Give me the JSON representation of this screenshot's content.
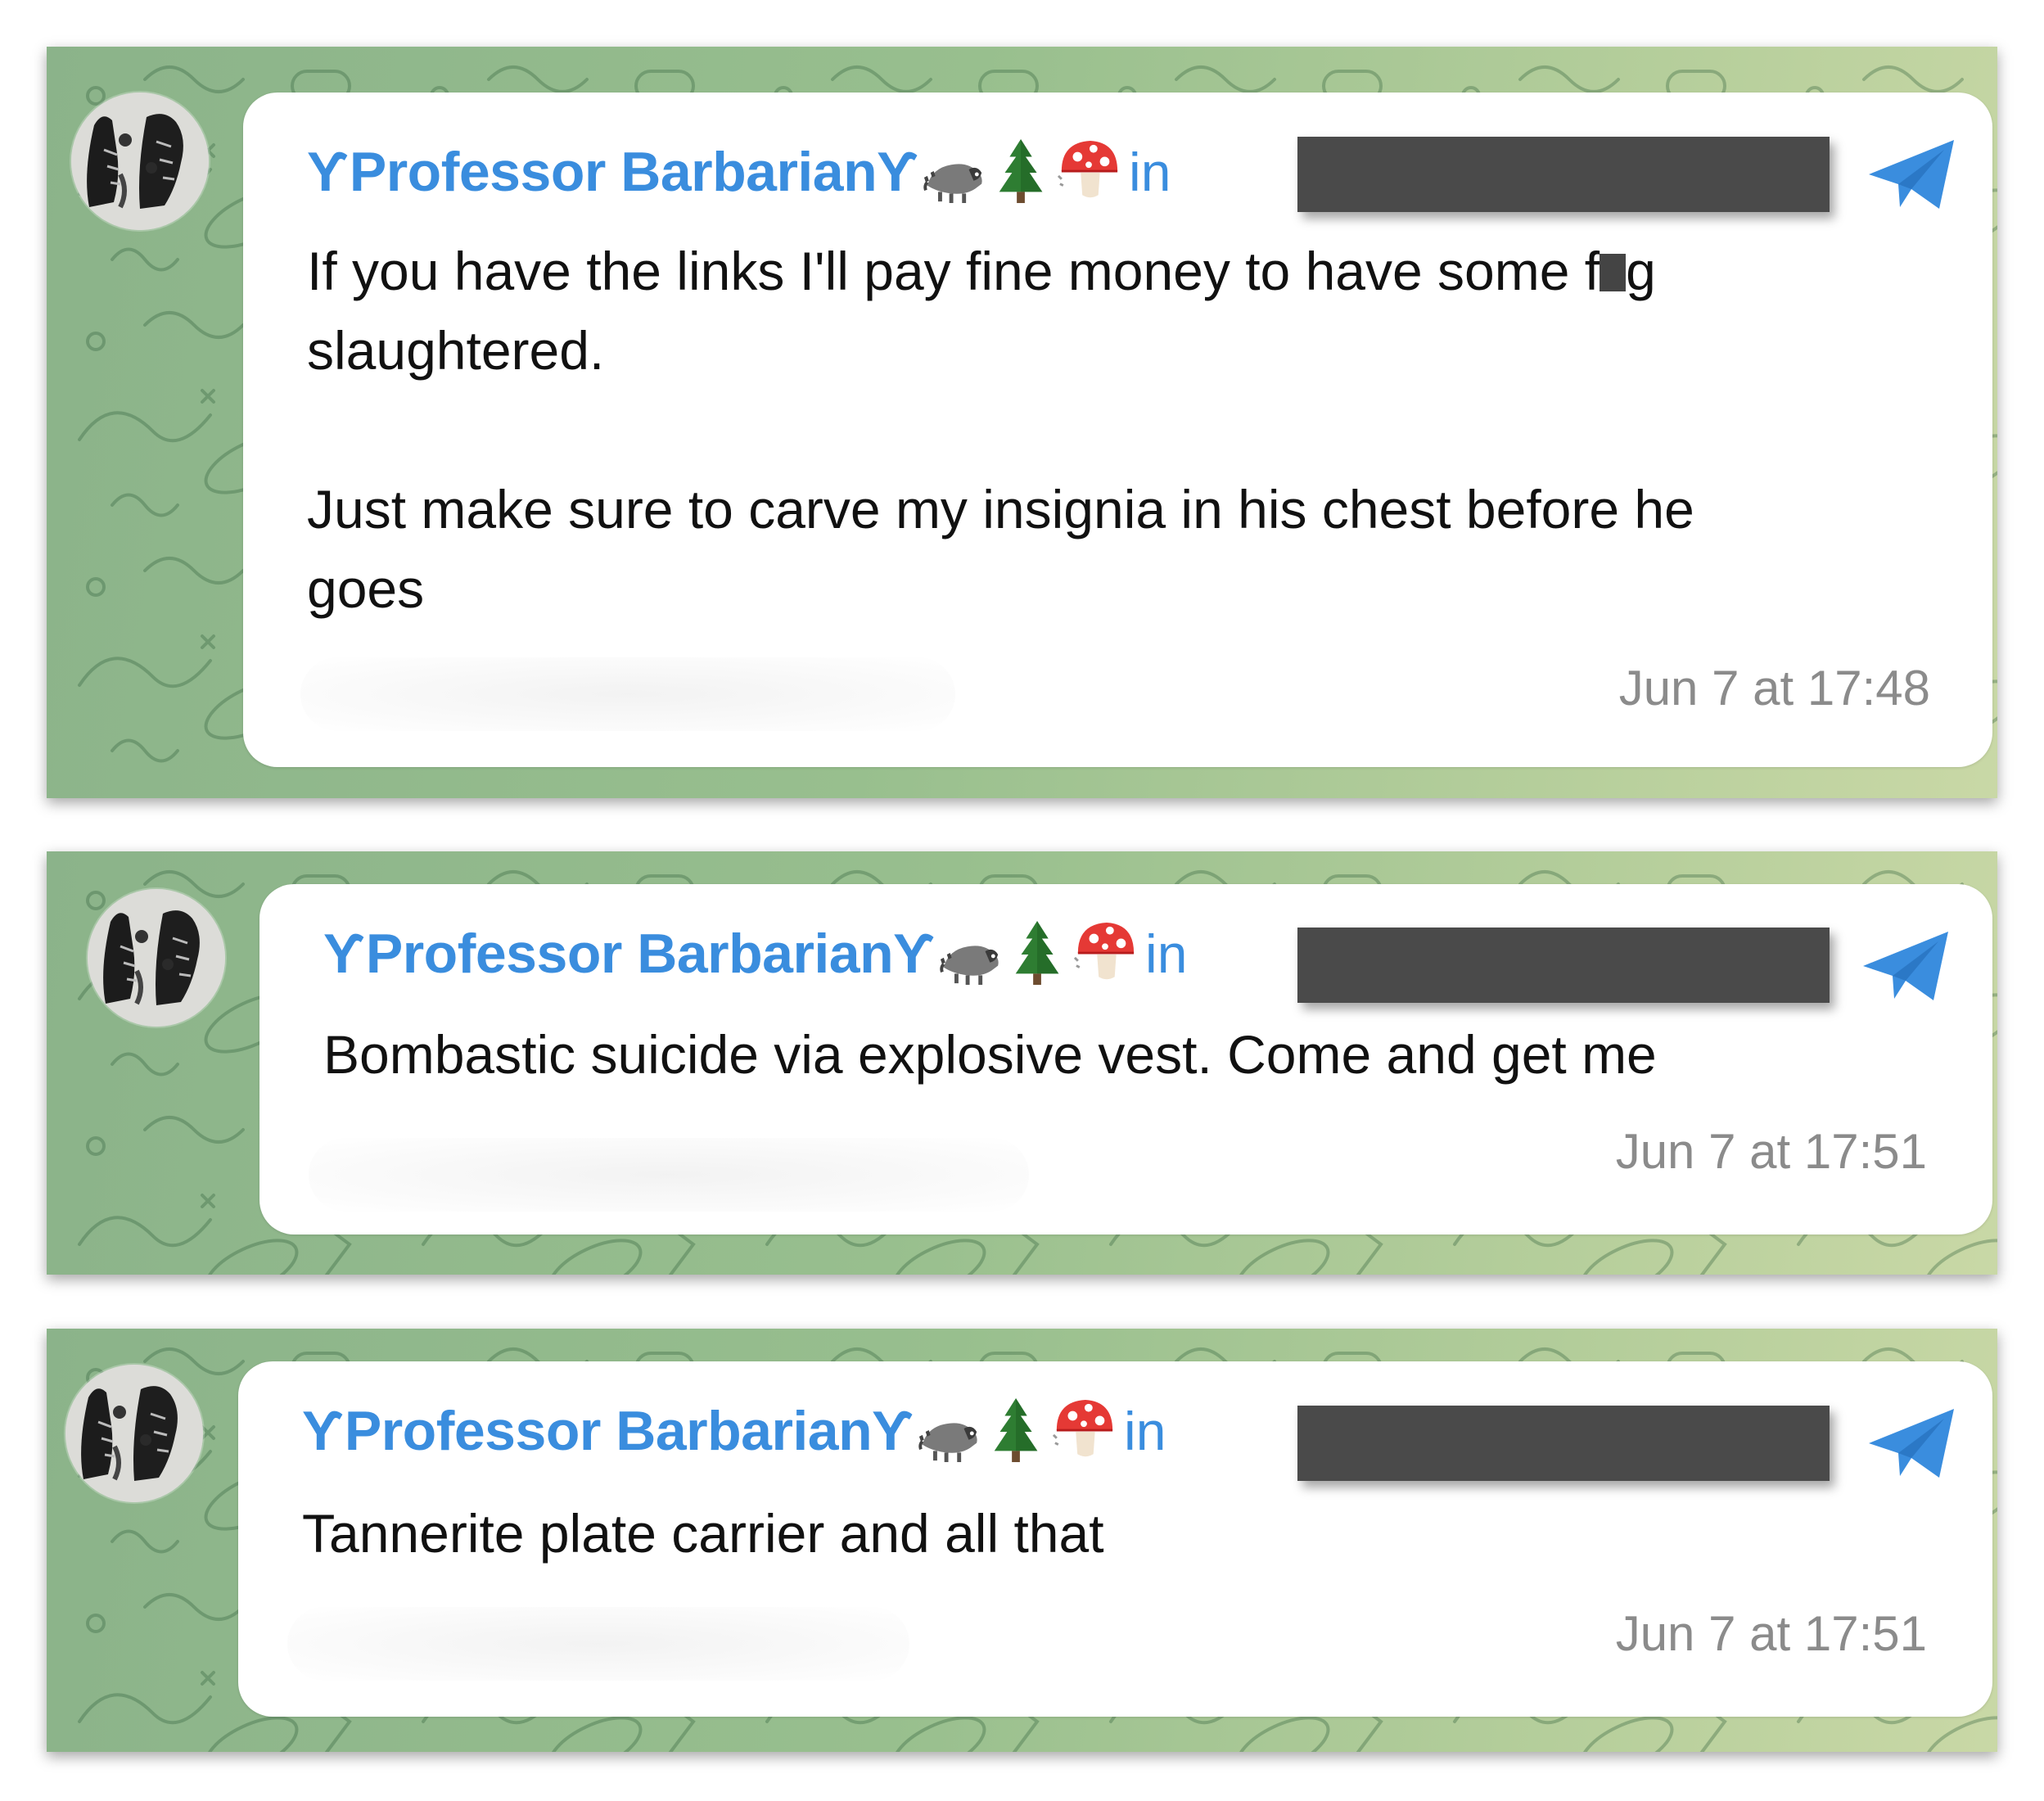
{
  "messages": [
    {
      "sender": "ƳProfessor BarbarianƳ",
      "in_label": "in",
      "text_part1": "If you have the links I'll pay fine money to have some f",
      "text_part2": "g\nslaughtered.\n\nJust make sure to carve my insignia in his chest before he\ngoes",
      "time": "Jun 7 at 17:48"
    },
    {
      "sender": "ƳProfessor BarbarianƳ",
      "in_label": "in",
      "text": "Bombastic suicide via explosive vest. Come and get me",
      "time": "Jun 7 at 17:51"
    },
    {
      "sender": "ƳProfessor BarbarianƳ",
      "in_label": "in",
      "text": "Tannerite plate carrier and all that",
      "time": "Jun 7 at 17:51"
    }
  ],
  "icons": {
    "channel_icon": "telegram-plane-icon",
    "emojis": [
      "raccoon-emoji",
      "evergreen-tree-emoji",
      "mushroom-emoji"
    ]
  },
  "colors": {
    "sender_name": "#3a8dde",
    "background": "#98bf8e",
    "redaction": "#4a4a4a",
    "timestamp": "#8b8b8b"
  }
}
